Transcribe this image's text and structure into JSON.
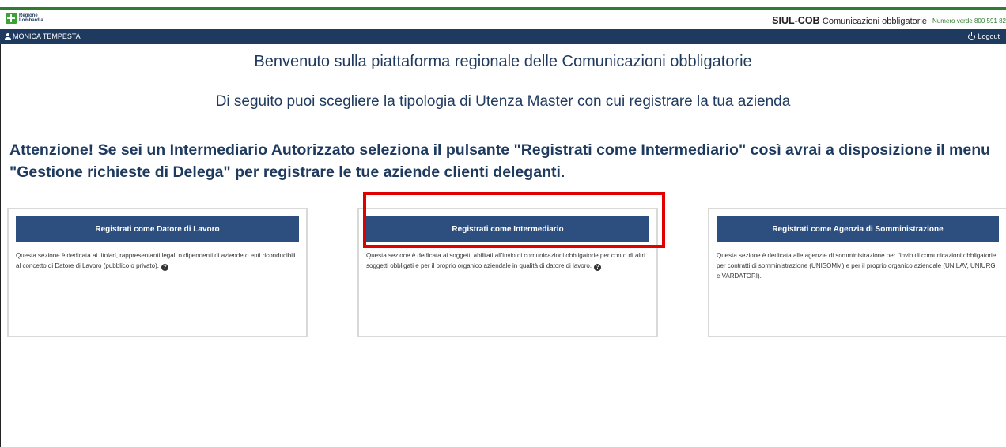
{
  "header": {
    "logo_line1": "Regione",
    "logo_line2": "Lombardia",
    "app_name": "SIUL-COB",
    "app_subtitle": "Comunicazioni obbligatorie",
    "phone_label": "Numero verde 800 591 82",
    "brand_color": "#2e7d32"
  },
  "userbar": {
    "user_name": "MONICA TEMPESTA",
    "logout_label": "Logout",
    "bar_color": "#1f3a5f"
  },
  "main": {
    "title": "Benvenuto sulla piattaforma regionale delle Comunicazioni obbligatorie",
    "subtitle": "Di seguito puoi scegliere la tipologia di Utenza Master con cui registrare la tua azienda",
    "attention": "Attenzione! Se sei un Intermediario Autorizzato seleziona il pulsante \"Registrati come Intermediario\" così avrai a disposizione il menu \"Gestione richieste di Delega\" per registrare le tue aziende clienti deleganti."
  },
  "cards": [
    {
      "button_label": "Registrati come Datore di Lavoro",
      "description": "Questa sezione è dedicata ai titolari, rappresentanti legali o dipendenti di aziende o enti riconducibili al concetto di Datore di Lavoro (pubblico o privato).",
      "help_icon": "question-circle-icon"
    },
    {
      "button_label": "Registrati come Intermediario",
      "description": "Questa sezione è dedicata ai soggetti abilitati all'invio di comunicazioni obbligatorie per conto di altri soggetti obbligati e per il proprio organico aziendale in qualità di datore di lavoro.",
      "help_icon": "question-circle-icon",
      "highlight_color": "#e00000"
    },
    {
      "button_label": "Registrati come Agenzia di Somministrazione",
      "description": "Questa sezione è dedicata alle agenzie di somministrazione per l'invio di comunicazioni obbligatorie per contratti di somministrazione (UNISOMM) e per il proprio organico aziendale (UNILAV, UNIURG e VARDATORI)."
    }
  ]
}
